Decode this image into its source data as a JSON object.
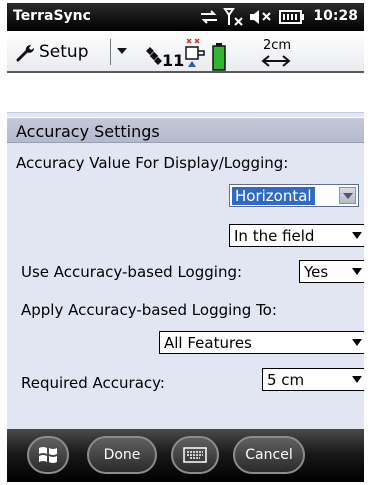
{
  "status_bar": {
    "app_title": "TerraSync",
    "time": "10:28",
    "icons": [
      "sync-icon",
      "no-signal-icon",
      "volume-icon",
      "battery-icon"
    ]
  },
  "command_bar": {
    "setup_label": "Setup",
    "satellite_count": "11",
    "accuracy_value": "2cm",
    "icons": [
      "wrench-icon",
      "dropdown-arrow-icon",
      "satellite-icon",
      "comm-icon",
      "receiver-battery-icon",
      "horizontal-arrow-icon"
    ]
  },
  "section": {
    "title": "Accuracy Settings"
  },
  "form": {
    "display_label": "Accuracy Value For Display/Logging:",
    "display_value": "Horizontal",
    "mode_value": "In the field",
    "use_logging_label": "Use Accuracy-based Logging:",
    "use_logging_value": "Yes",
    "apply_to_label": "Apply Accuracy-based Logging To:",
    "apply_to_value": "All Features",
    "required_label": "Required Accuracy:",
    "required_value": "5 cm"
  },
  "softkeys": {
    "done": "Done",
    "cancel": "Cancel"
  },
  "colors": {
    "selection": "#316ac5",
    "form_background": "#e2e5f2",
    "softkey_bar": "#000000"
  }
}
